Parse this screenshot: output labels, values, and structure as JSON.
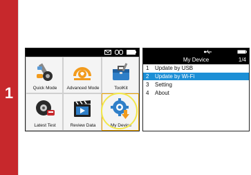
{
  "step": "1",
  "left_screen": {
    "tiles": [
      {
        "label": "Quick Mode"
      },
      {
        "label": "Advanced Mode"
      },
      {
        "label": "ToolKit"
      },
      {
        "label": "Latest Test"
      },
      {
        "label": "Review Data"
      },
      {
        "label": "My Device"
      }
    ],
    "selected": "My Device"
  },
  "right_screen": {
    "title": "My Device",
    "page": "1/4",
    "menu": [
      {
        "num": "1",
        "label": "Update by USB"
      },
      {
        "num": "2",
        "label": "Update by Wi-Fi"
      },
      {
        "num": "3",
        "label": "Setting"
      },
      {
        "num": "4",
        "label": "About"
      }
    ],
    "active_index": 1
  },
  "colors": {
    "step_bar": "#c7282c",
    "highlight": "#1c8fd6",
    "selection_ring": "#f3e84a"
  }
}
